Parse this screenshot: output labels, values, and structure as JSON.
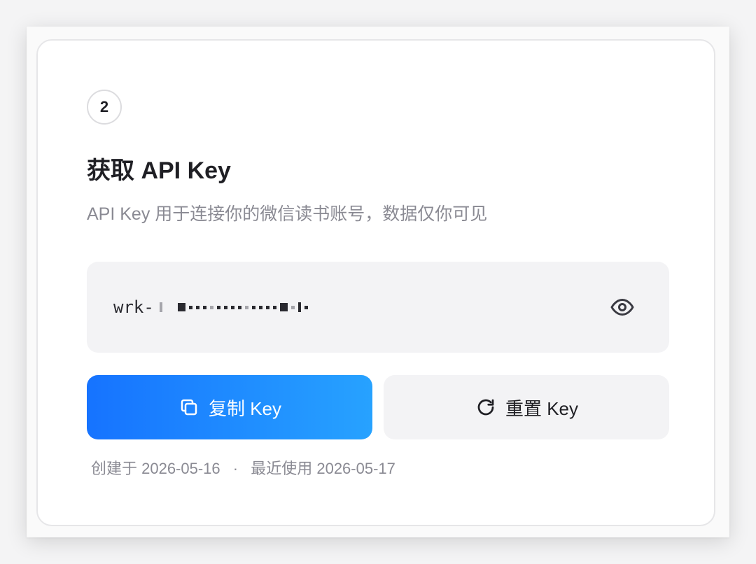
{
  "step": {
    "number": "2"
  },
  "card": {
    "title": "获取 API Key",
    "subtitle": "API Key 用于连接你的微信读书账号，数据仅你可见"
  },
  "api_key": {
    "prefix": "wrk-",
    "masked": true,
    "visibility_icon": "eye-icon"
  },
  "buttons": {
    "copy": {
      "label": "复制 Key",
      "icon": "copy-icon"
    },
    "reset": {
      "label": "重置 Key",
      "icon": "refresh-icon"
    }
  },
  "meta": {
    "created": "创建于 2026-05-16",
    "separator": "·",
    "last_used": "最近使用 2026-05-17"
  },
  "colors": {
    "primary_gradient_start": "#1673ff",
    "primary_gradient_end": "#27a2ff",
    "text_primary": "#1f1f24",
    "text_secondary": "#8a8a93",
    "surface": "#f3f3f5"
  }
}
